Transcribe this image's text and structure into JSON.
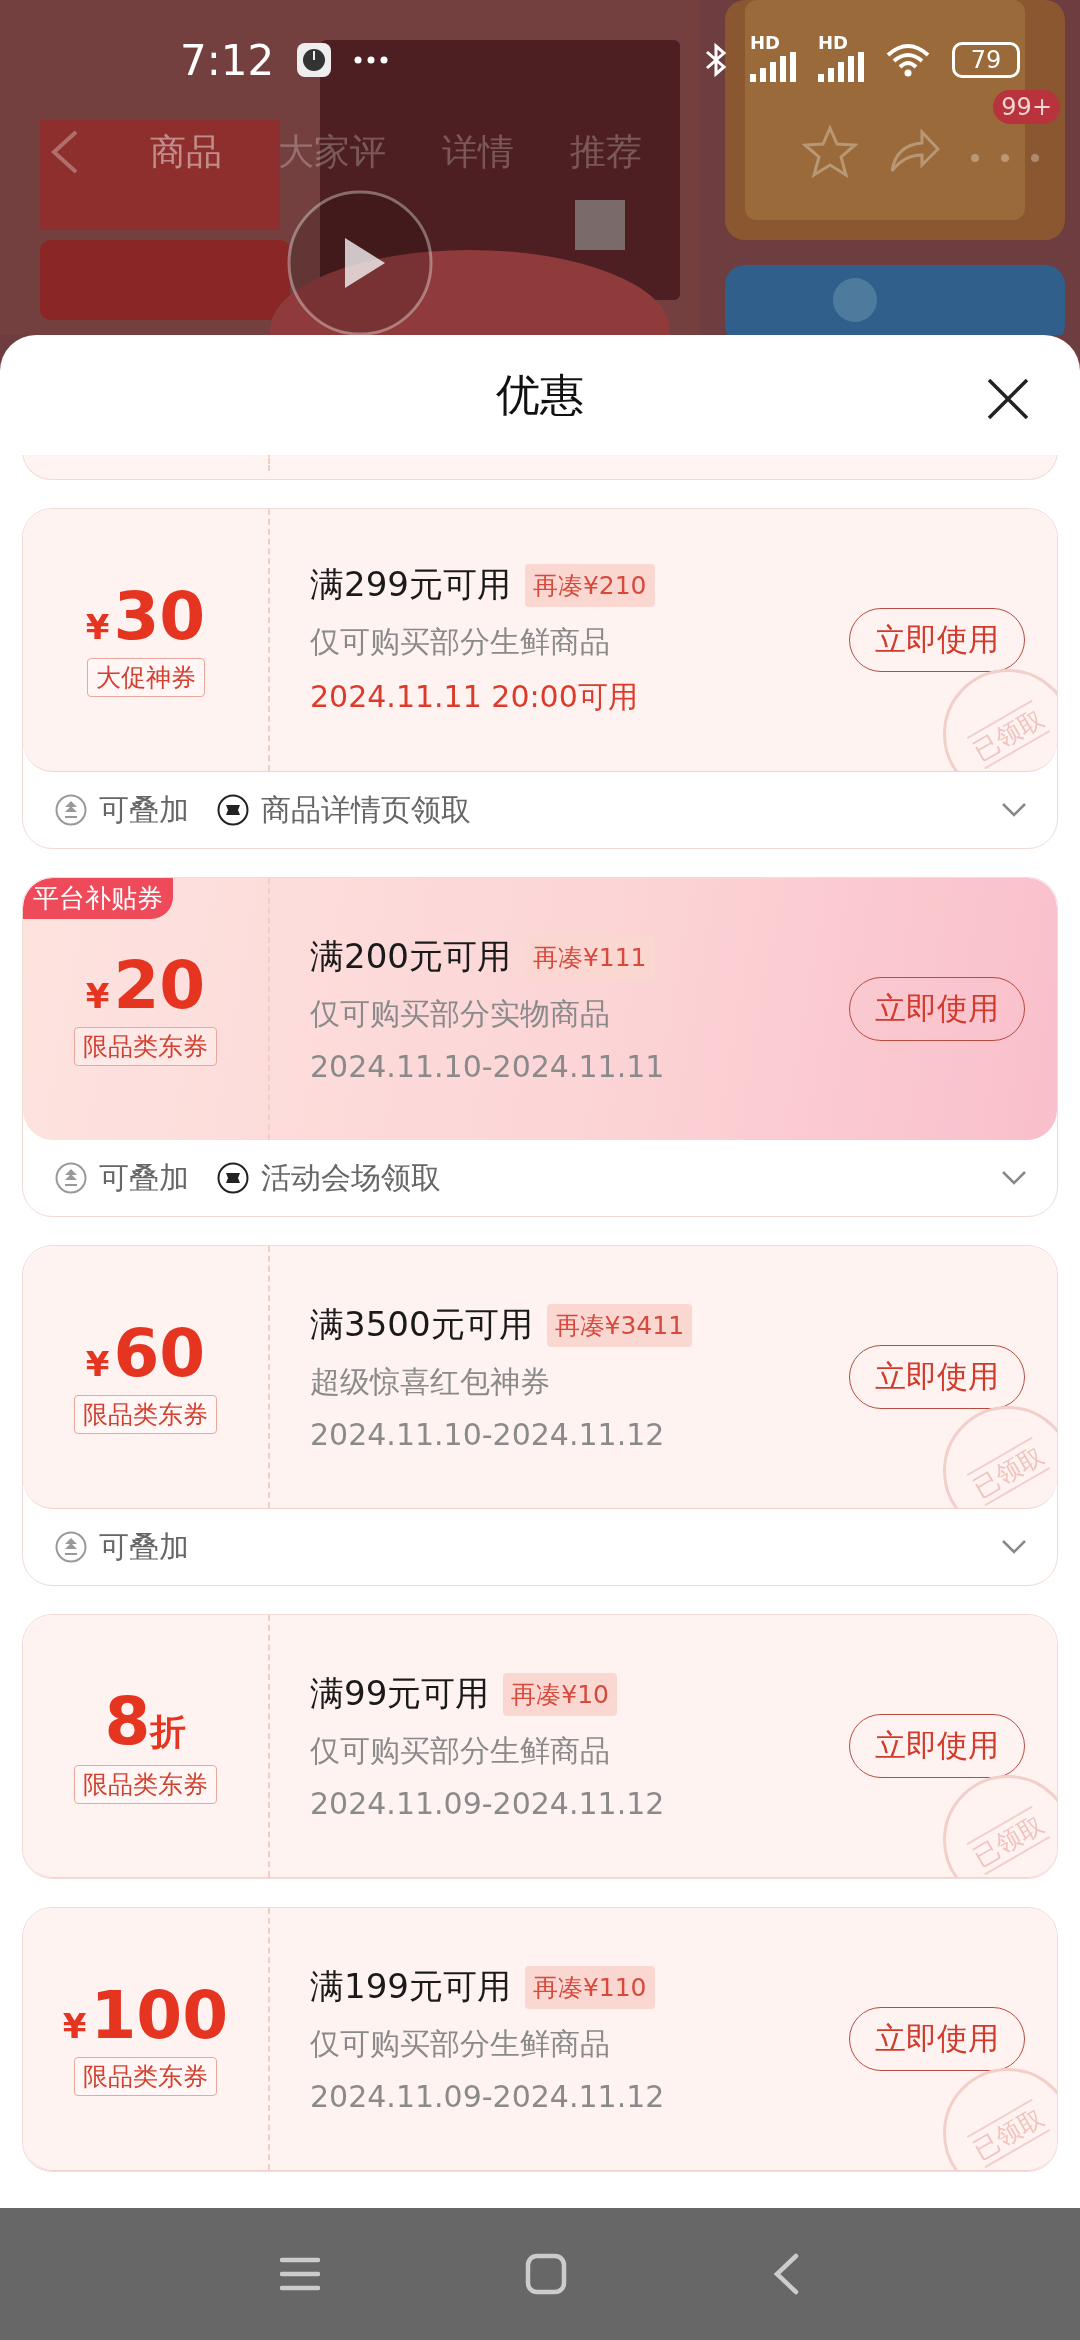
{
  "status_bar": {
    "time": "7:12",
    "network_labels": [
      "HD",
      "HD"
    ],
    "battery": "79"
  },
  "page_tabs": [
    {
      "label": "商品",
      "selected": true
    },
    {
      "label": "大家评",
      "selected": false
    },
    {
      "label": "详情",
      "selected": false
    },
    {
      "label": "推荐",
      "selected": false
    }
  ],
  "cart_badge": "99+",
  "sheet": {
    "title": "优惠"
  },
  "coupons": [
    {
      "kind": "normal",
      "currency": "¥",
      "amount": "30",
      "tag": "大促神券",
      "condition": "满299元可用",
      "gap": "再凑¥210",
      "scope": "仅可购买部分生鲜商品",
      "date": "2024.11.11 20:00可用",
      "date_highlight": true,
      "button": "立即使用",
      "stamp": "已领取",
      "footer": [
        {
          "kind": "stackable",
          "text": "可叠加"
        },
        {
          "kind": "source",
          "text": "商品详情页领取"
        }
      ]
    },
    {
      "kind": "subsidy",
      "corner_tag": "平台补贴券",
      "currency": "¥",
      "amount": "20",
      "tag": "限品类东券",
      "condition": "满200元可用",
      "gap": "再凑¥111",
      "scope": "仅可购买部分实物商品",
      "date": "2024.11.10-2024.11.11",
      "date_highlight": false,
      "button": "立即使用",
      "footer": [
        {
          "kind": "stackable",
          "text": "可叠加"
        },
        {
          "kind": "source",
          "text": "活动会场领取"
        }
      ]
    },
    {
      "kind": "normal",
      "currency": "¥",
      "amount": "60",
      "tag": "限品类东券",
      "condition": "满3500元可用",
      "gap": "再凑¥3411",
      "scope": "超级惊喜红包神券",
      "date": "2024.11.10-2024.11.12",
      "date_highlight": false,
      "button": "立即使用",
      "stamp": "已领取",
      "footer": [
        {
          "kind": "stackable",
          "text": "可叠加"
        }
      ]
    },
    {
      "kind": "normal",
      "amount": "8",
      "unit": "折",
      "tag": "限品类东券",
      "condition": "满99元可用",
      "gap": "再凑¥10",
      "scope": "仅可购买部分生鲜商品",
      "date": "2024.11.09-2024.11.12",
      "date_highlight": false,
      "button": "立即使用",
      "stamp": "已领取"
    },
    {
      "kind": "normal",
      "currency": "¥",
      "amount": "100",
      "tag": "限品类东券",
      "condition": "满199元可用",
      "gap": "再凑¥110",
      "scope": "仅可购买部分生鲜商品",
      "date": "2024.11.09-2024.11.12",
      "date_highlight": false,
      "button": "立即使用",
      "stamp": "已领取"
    }
  ]
}
